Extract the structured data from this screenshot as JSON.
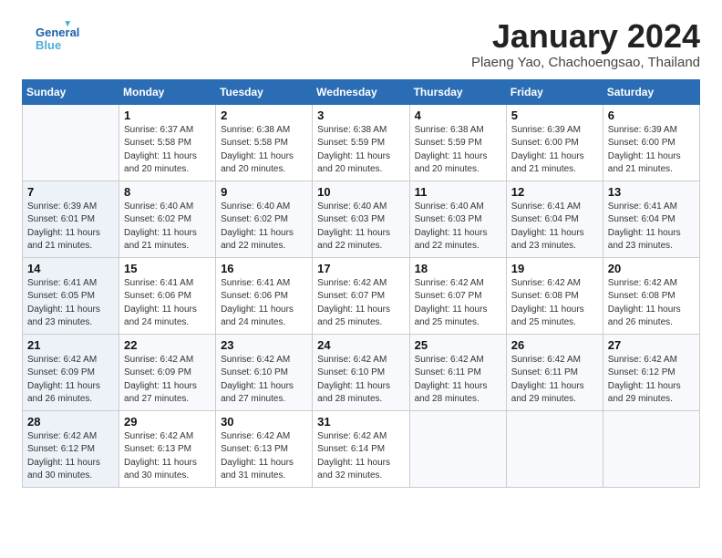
{
  "header": {
    "logo_line1": "General",
    "logo_line2": "Blue",
    "month": "January 2024",
    "location": "Plaeng Yao, Chachoengsao, Thailand"
  },
  "days_of_week": [
    "Sunday",
    "Monday",
    "Tuesday",
    "Wednesday",
    "Thursday",
    "Friday",
    "Saturday"
  ],
  "weeks": [
    [
      {
        "num": "",
        "info": ""
      },
      {
        "num": "1",
        "info": "Sunrise: 6:37 AM\nSunset: 5:58 PM\nDaylight: 11 hours\nand 20 minutes."
      },
      {
        "num": "2",
        "info": "Sunrise: 6:38 AM\nSunset: 5:58 PM\nDaylight: 11 hours\nand 20 minutes."
      },
      {
        "num": "3",
        "info": "Sunrise: 6:38 AM\nSunset: 5:59 PM\nDaylight: 11 hours\nand 20 minutes."
      },
      {
        "num": "4",
        "info": "Sunrise: 6:38 AM\nSunset: 5:59 PM\nDaylight: 11 hours\nand 20 minutes."
      },
      {
        "num": "5",
        "info": "Sunrise: 6:39 AM\nSunset: 6:00 PM\nDaylight: 11 hours\nand 21 minutes."
      },
      {
        "num": "6",
        "info": "Sunrise: 6:39 AM\nSunset: 6:00 PM\nDaylight: 11 hours\nand 21 minutes."
      }
    ],
    [
      {
        "num": "7",
        "info": "Sunrise: 6:39 AM\nSunset: 6:01 PM\nDaylight: 11 hours\nand 21 minutes."
      },
      {
        "num": "8",
        "info": "Sunrise: 6:40 AM\nSunset: 6:02 PM\nDaylight: 11 hours\nand 21 minutes."
      },
      {
        "num": "9",
        "info": "Sunrise: 6:40 AM\nSunset: 6:02 PM\nDaylight: 11 hours\nand 22 minutes."
      },
      {
        "num": "10",
        "info": "Sunrise: 6:40 AM\nSunset: 6:03 PM\nDaylight: 11 hours\nand 22 minutes."
      },
      {
        "num": "11",
        "info": "Sunrise: 6:40 AM\nSunset: 6:03 PM\nDaylight: 11 hours\nand 22 minutes."
      },
      {
        "num": "12",
        "info": "Sunrise: 6:41 AM\nSunset: 6:04 PM\nDaylight: 11 hours\nand 23 minutes."
      },
      {
        "num": "13",
        "info": "Sunrise: 6:41 AM\nSunset: 6:04 PM\nDaylight: 11 hours\nand 23 minutes."
      }
    ],
    [
      {
        "num": "14",
        "info": "Sunrise: 6:41 AM\nSunset: 6:05 PM\nDaylight: 11 hours\nand 23 minutes."
      },
      {
        "num": "15",
        "info": "Sunrise: 6:41 AM\nSunset: 6:06 PM\nDaylight: 11 hours\nand 24 minutes."
      },
      {
        "num": "16",
        "info": "Sunrise: 6:41 AM\nSunset: 6:06 PM\nDaylight: 11 hours\nand 24 minutes."
      },
      {
        "num": "17",
        "info": "Sunrise: 6:42 AM\nSunset: 6:07 PM\nDaylight: 11 hours\nand 25 minutes."
      },
      {
        "num": "18",
        "info": "Sunrise: 6:42 AM\nSunset: 6:07 PM\nDaylight: 11 hours\nand 25 minutes."
      },
      {
        "num": "19",
        "info": "Sunrise: 6:42 AM\nSunset: 6:08 PM\nDaylight: 11 hours\nand 25 minutes."
      },
      {
        "num": "20",
        "info": "Sunrise: 6:42 AM\nSunset: 6:08 PM\nDaylight: 11 hours\nand 26 minutes."
      }
    ],
    [
      {
        "num": "21",
        "info": "Sunrise: 6:42 AM\nSunset: 6:09 PM\nDaylight: 11 hours\nand 26 minutes."
      },
      {
        "num": "22",
        "info": "Sunrise: 6:42 AM\nSunset: 6:09 PM\nDaylight: 11 hours\nand 27 minutes."
      },
      {
        "num": "23",
        "info": "Sunrise: 6:42 AM\nSunset: 6:10 PM\nDaylight: 11 hours\nand 27 minutes."
      },
      {
        "num": "24",
        "info": "Sunrise: 6:42 AM\nSunset: 6:10 PM\nDaylight: 11 hours\nand 28 minutes."
      },
      {
        "num": "25",
        "info": "Sunrise: 6:42 AM\nSunset: 6:11 PM\nDaylight: 11 hours\nand 28 minutes."
      },
      {
        "num": "26",
        "info": "Sunrise: 6:42 AM\nSunset: 6:11 PM\nDaylight: 11 hours\nand 29 minutes."
      },
      {
        "num": "27",
        "info": "Sunrise: 6:42 AM\nSunset: 6:12 PM\nDaylight: 11 hours\nand 29 minutes."
      }
    ],
    [
      {
        "num": "28",
        "info": "Sunrise: 6:42 AM\nSunset: 6:12 PM\nDaylight: 11 hours\nand 30 minutes."
      },
      {
        "num": "29",
        "info": "Sunrise: 6:42 AM\nSunset: 6:13 PM\nDaylight: 11 hours\nand 30 minutes."
      },
      {
        "num": "30",
        "info": "Sunrise: 6:42 AM\nSunset: 6:13 PM\nDaylight: 11 hours\nand 31 minutes."
      },
      {
        "num": "31",
        "info": "Sunrise: 6:42 AM\nSunset: 6:14 PM\nDaylight: 11 hours\nand 32 minutes."
      },
      {
        "num": "",
        "info": ""
      },
      {
        "num": "",
        "info": ""
      },
      {
        "num": "",
        "info": ""
      }
    ]
  ]
}
